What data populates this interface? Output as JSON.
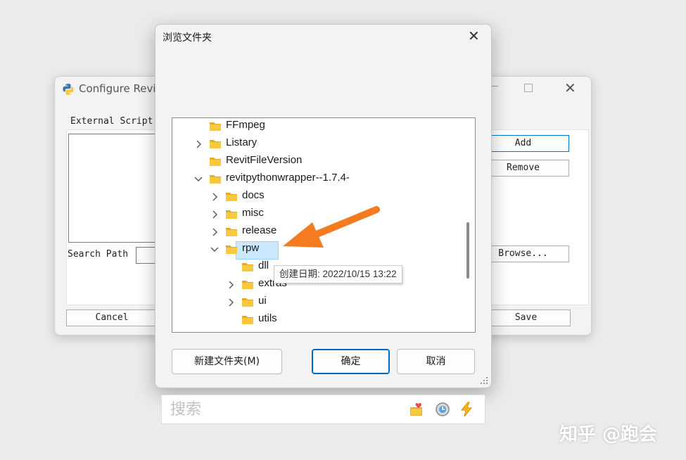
{
  "background_window": {
    "title": "Configure Revit",
    "external_scripts_label": "External Script",
    "search_path_label": "Search Path",
    "buttons": {
      "add": "Add",
      "remove": "Remove",
      "browse": "Browse...",
      "cancel": "Cancel",
      "save": "Save"
    }
  },
  "dialog": {
    "title": "浏览文件夹",
    "tree": [
      {
        "label": "FFmpeg",
        "expander": "none",
        "level": 0
      },
      {
        "label": "Listary",
        "expander": "collapsed",
        "level": 0
      },
      {
        "label": "RevitFileVersion",
        "expander": "none",
        "level": 0
      },
      {
        "label": "revitpythonwrapper--1.7.4-",
        "expander": "expanded",
        "level": 0
      },
      {
        "label": "docs",
        "expander": "collapsed",
        "level": 1
      },
      {
        "label": "misc",
        "expander": "collapsed",
        "level": 1
      },
      {
        "label": "release",
        "expander": "collapsed",
        "level": 1
      },
      {
        "label": "rpw",
        "expander": "expanded",
        "level": 1,
        "selected": true
      },
      {
        "label": "dll",
        "expander": "none",
        "level": 2
      },
      {
        "label": "extras",
        "expander": "collapsed",
        "level": 2
      },
      {
        "label": "ui",
        "expander": "collapsed",
        "level": 2
      },
      {
        "label": "utils",
        "expander": "none",
        "level": 2
      }
    ],
    "tooltip": "创建日期: 2022/10/15 13:22",
    "buttons": {
      "new_folder": "新建文件夹(M)",
      "ok": "确定",
      "cancel": "取消"
    }
  },
  "search_bar": {
    "placeholder": "搜索"
  },
  "watermark": "知乎 @跑会",
  "colors": {
    "folder": "#f8c93c",
    "selection": "#cce8ff",
    "arrow": "#f47b20",
    "primary_border": "#0067c0"
  }
}
